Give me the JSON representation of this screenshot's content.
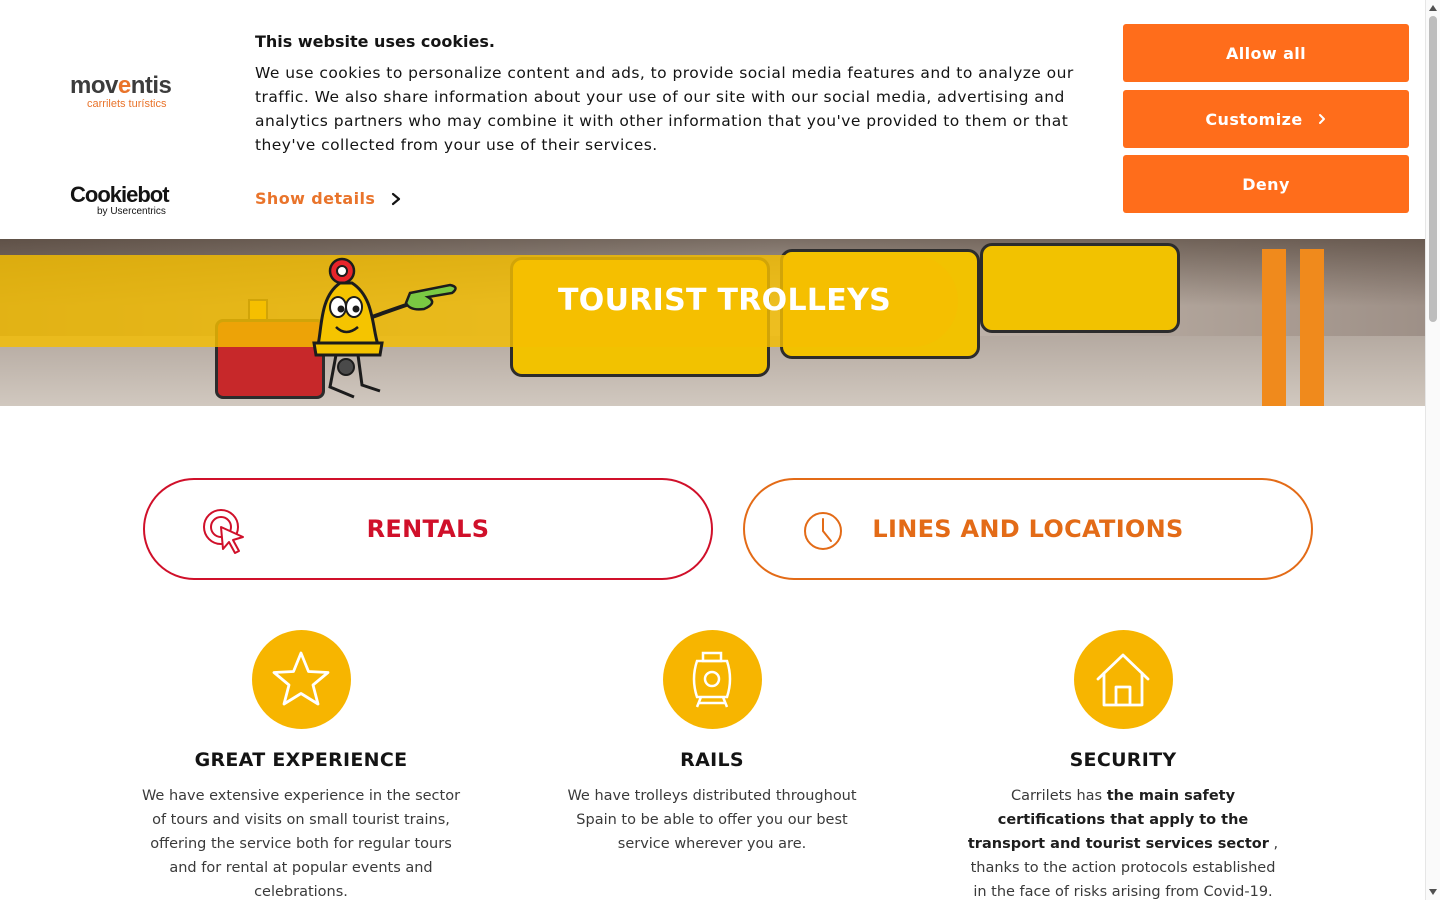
{
  "cookie_banner": {
    "moventis_logo": {
      "brand_prefix": "mov",
      "brand_accent": "e",
      "brand_suffix": "ntis",
      "tagline": "carrilets turístics"
    },
    "cookiebot_logo": {
      "brand": "Cookiebot",
      "tagline": "by Usercentrics"
    },
    "title": "This website uses cookies.",
    "description": "We use cookies to personalize content and ads, to provide social media features and to analyze our traffic. We also share information about your use of our site with our social media, advertising and analytics partners who may combine it with other information that you've provided to them or that they've collected from your use of their services.",
    "show_details_label": "Show details",
    "buttons": {
      "allow_all": "Allow all",
      "customize": "Customize",
      "deny": "Deny"
    },
    "accent_color": "#ff6d1b"
  },
  "hero": {
    "title": "TOURIST TROLLEYS",
    "band_color": "#f5be00"
  },
  "actions": {
    "rentals": {
      "label": "RENTALS",
      "icon": "cursor-click-icon",
      "color": "#d0102a"
    },
    "lines": {
      "label": "LINES AND LOCATIONS",
      "icon": "clock-icon",
      "color": "#e36b17"
    }
  },
  "features": [
    {
      "icon": "star-icon",
      "heading": "GREAT EXPERIENCE",
      "text": "We have extensive experience in the sector of tours and visits on small tourist trains, offering the service both for regular tours and for rental at popular events and celebrations."
    },
    {
      "icon": "train-icon",
      "heading": "RAILS",
      "text": "We have trolleys distributed throughout Spain to be able to offer you our best service wherever you are."
    },
    {
      "icon": "house-icon",
      "heading": "SECURITY",
      "text_before": "Carrilets has",
      "text_bold": "the main safety certifications that apply to the transport and tourist services sector",
      "text_after": ", thanks to the action protocols established in the face of risks arising from Covid-19."
    }
  ]
}
